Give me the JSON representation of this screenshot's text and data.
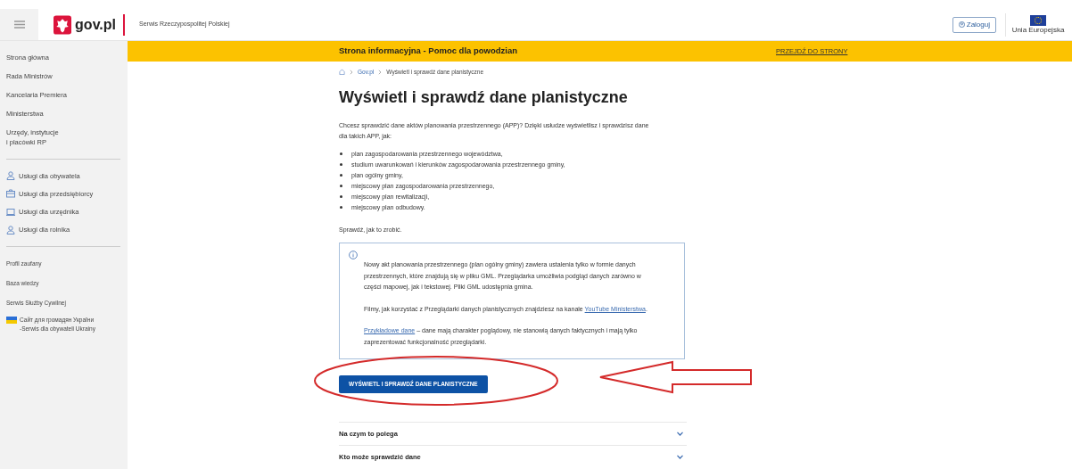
{
  "header": {
    "logo": "gov.pl",
    "service_name": "Serwis Rzeczypospolitej Polskiej",
    "login_button": "Zaloguj",
    "eu_label": "Unia Europejska"
  },
  "sidebar": {
    "main_links": [
      "Strona główna",
      "Rada Ministrów",
      "Kancelaria Premiera",
      "Ministerstwa",
      "Urzędy, instytucje\ni placówki RP"
    ],
    "services": [
      {
        "label": "Usługi dla obywatela",
        "kind": "person"
      },
      {
        "label": "Usługi dla przedsiębiorcy",
        "kind": "briefcase"
      },
      {
        "label": "Usługi dla urzędnika",
        "kind": "laptop"
      },
      {
        "label": "Usługi dla rolnika",
        "kind": "person"
      }
    ],
    "small_links": [
      {
        "label": "Profil zaufany",
        "kind": "plain"
      },
      {
        "label": "Baza wiedzy",
        "kind": "plain"
      },
      {
        "label": "Serwis Służby Cywilnej",
        "kind": "plain"
      },
      {
        "label": "Сайт для громадян України\n-Serwis dla obywateli Ukrainy",
        "kind": "flag"
      }
    ]
  },
  "banner": {
    "text": "Strona informacyjna - Pomoc dla powodzian",
    "link": "PRZEJDŹ DO STRONY"
  },
  "breadcrumb": [
    "Gov.pl",
    "Wyświetl i sprawdź dane planistyczne"
  ],
  "title": "Wyświetl i sprawdź dane planistyczne",
  "intro": "Chcesz sprawdzić dane aktów planowania przestrzennego (APP)? Dzięki usłudze wyświetlisz i sprawdzisz dane dla takich APP, jak:",
  "plan_types": [
    "plan zagospodarowania przestrzennego województwa,",
    "studium uwarunkowań i kierunków zagospodarowania przestrzennego gminy,",
    "plan ogólny gminy,",
    "miejscowy plan zagospodarowania przestrzennego,",
    "miejscowy plan rewitalizacji,",
    "miejscowy plan odbudowy."
  ],
  "check_how": "Sprawdź, jak to zrobić.",
  "info_box": {
    "paragraph": "Nowy akt planowania przestrzennego (plan ogólny gminy) zawiera ustalenia tylko w formie danych przestrzennych, które znajdują się w pliku GML. Przeglądarka umożliwia podgląd danych zarówno w części mapowej, jak i tekstowej. Pliki GML udostępnia gmina.",
    "films_text": "Filmy, jak korzystać z Przeglądarki danych planistycznych znajdziesz na kanale",
    "films_link": "YouTube Ministerstwa",
    "films_end": ".",
    "sample_link": "Przykładowe dane",
    "sample_text": " – dane mają charakter poglądowy, nie stanowią danych faktycznych i mają tylko zaprezentować funkcjonalność przeglądarki."
  },
  "main_button": "WYŚWIETL I SPRAWDŹ DANE PLANISTYCZNE",
  "accordion": [
    {
      "title": "Na czym to polega",
      "expanded": false
    },
    {
      "title": "Kto może sprawdzić dane",
      "expanded": false
    }
  ]
}
